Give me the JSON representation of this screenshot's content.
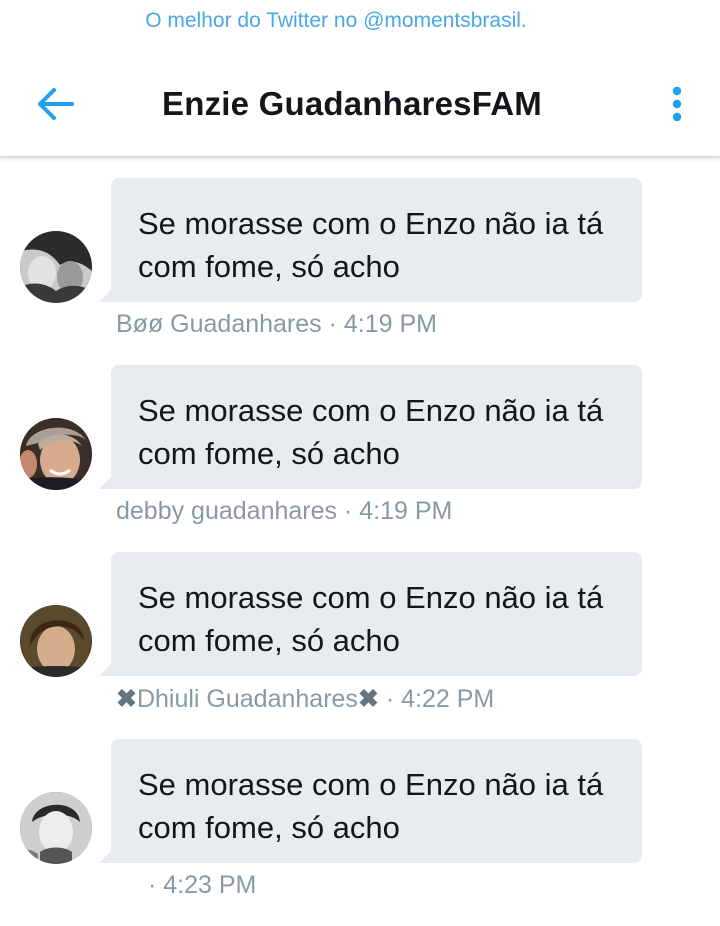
{
  "credit": "O melhor do Twitter no @momentsbrasil.",
  "header": {
    "title": "Enzie GuadanharesFAM",
    "back_icon": "arrow-left-icon",
    "menu_icon": "more-vertical-icon",
    "accent_color": "#1da1f2"
  },
  "messages": [
    {
      "text_line1": "Se morasse com o Enzo não ia tá",
      "text_line2": "com fome, só acho",
      "sender": "Bøø Guadanhares",
      "time": "· 4:19 PM"
    },
    {
      "text_line1": "Se morasse com o Enzo não ia tá",
      "text_line2": "com fome, só acho",
      "sender": "debby guadanhares",
      "time": "· 4:19 PM"
    },
    {
      "text_line1": "Se morasse com o Enzo não ia tá",
      "text_line2": "com fome, só acho",
      "sender_prefix": "✖",
      "sender": "Dhiuli Guadanhares",
      "sender_suffix": "✖",
      "time": "· 4:22 PM"
    },
    {
      "text_line1": "Se morasse com o Enzo não ia tá",
      "text_line2": "com fome, só acho",
      "sender": "",
      "time": "· 4:23 PM"
    }
  ],
  "colors": {
    "bubble": "#e6ecf0",
    "meta_text": "#8899a6",
    "credit_text": "#4aa8e5"
  }
}
